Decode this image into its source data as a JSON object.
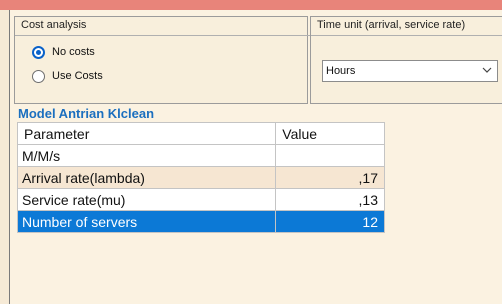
{
  "cost_group": {
    "title": "Cost analysis",
    "options": [
      {
        "label": "No costs",
        "selected": true
      },
      {
        "label": "Use Costs",
        "selected": false
      }
    ]
  },
  "time_group": {
    "title": "Time unit (arrival, service rate)",
    "selected": "Hours"
  },
  "model": {
    "title": "Model Antrian Klclean",
    "headers": [
      "Parameter",
      "Value"
    ],
    "rows": [
      {
        "parameter": "M/M/s",
        "value": ""
      },
      {
        "parameter": "Arrival rate(lambda)",
        "value": ",17"
      },
      {
        "parameter": "Service rate(mu)",
        "value": ",13"
      },
      {
        "parameter": "Number of servers",
        "value": "12"
      }
    ]
  },
  "colors": {
    "accent": "#0c79d6",
    "title_blue": "#1b6fbf",
    "background": "#fbf2e1",
    "title_bar": "#e8847a"
  }
}
